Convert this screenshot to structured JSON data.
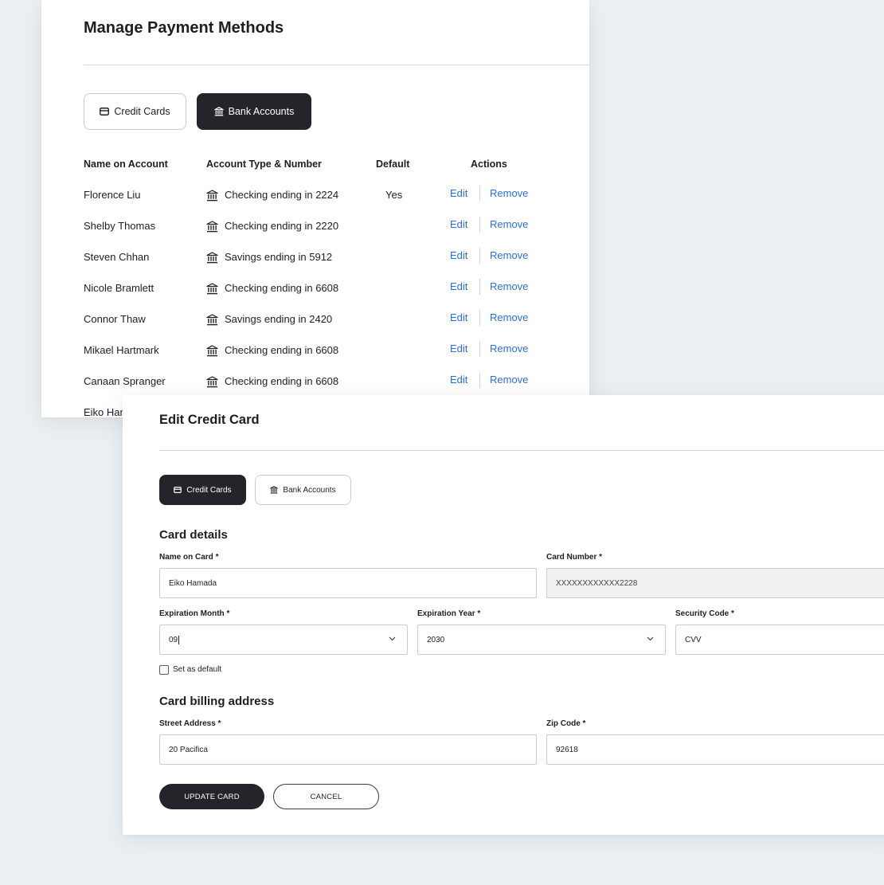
{
  "manage": {
    "title": "Manage Payment Methods",
    "tabs": [
      {
        "label": "Credit Cards",
        "icon": "credit-card-icon"
      },
      {
        "label": "Bank Accounts",
        "icon": "bank-icon"
      }
    ],
    "columns": [
      "Name on Account",
      "Account Type & Number",
      "Default",
      "Actions"
    ],
    "rows": [
      {
        "name": "Florence Liu",
        "type": "Checking ending in 2224",
        "default": "Yes"
      },
      {
        "name": "Shelby Thomas",
        "type": "Checking ending in 2220",
        "default": ""
      },
      {
        "name": "Steven Chhan",
        "type": "Savings ending in 5912",
        "default": ""
      },
      {
        "name": "Nicole Bramlett",
        "type": "Checking ending in 6608",
        "default": ""
      },
      {
        "name": "Connor Thaw",
        "type": "Savings ending in 2420",
        "default": ""
      },
      {
        "name": "Mikael Hartmark",
        "type": "Checking ending in 6608",
        "default": ""
      },
      {
        "name": "Canaan Spranger",
        "type": "Checking ending in 6608",
        "default": ""
      },
      {
        "name": "Eiko Ham",
        "type": "",
        "default": ""
      }
    ],
    "actions": {
      "edit": "Edit",
      "remove": "Remove"
    }
  },
  "edit": {
    "title": "Edit Credit Card",
    "tabs": [
      {
        "label": "Credit Cards",
        "icon": "credit-card-icon"
      },
      {
        "label": "Bank Accounts",
        "icon": "bank-icon"
      }
    ],
    "card_details": {
      "heading": "Card details",
      "name_label": "Name on Card *",
      "name_value": "Eiko Hamada",
      "number_label": "Card Number *",
      "number_value": "XXXXXXXXXXXX2228",
      "month_label": "Expiration Month *",
      "month_value": "09",
      "year_label": "Expiration Year *",
      "year_value": "2030",
      "cvv_label": "Security Code *",
      "cvv_placeholder": "CVV",
      "default_label": "Set as default"
    },
    "billing": {
      "heading": "Card billing address",
      "street_label": "Street Address *",
      "street_value": "20 Pacifica",
      "zip_label": "Zip Code *",
      "zip_value": "92618"
    },
    "buttons": {
      "update": "UPDATE CARD",
      "cancel": "CANCEL"
    }
  }
}
